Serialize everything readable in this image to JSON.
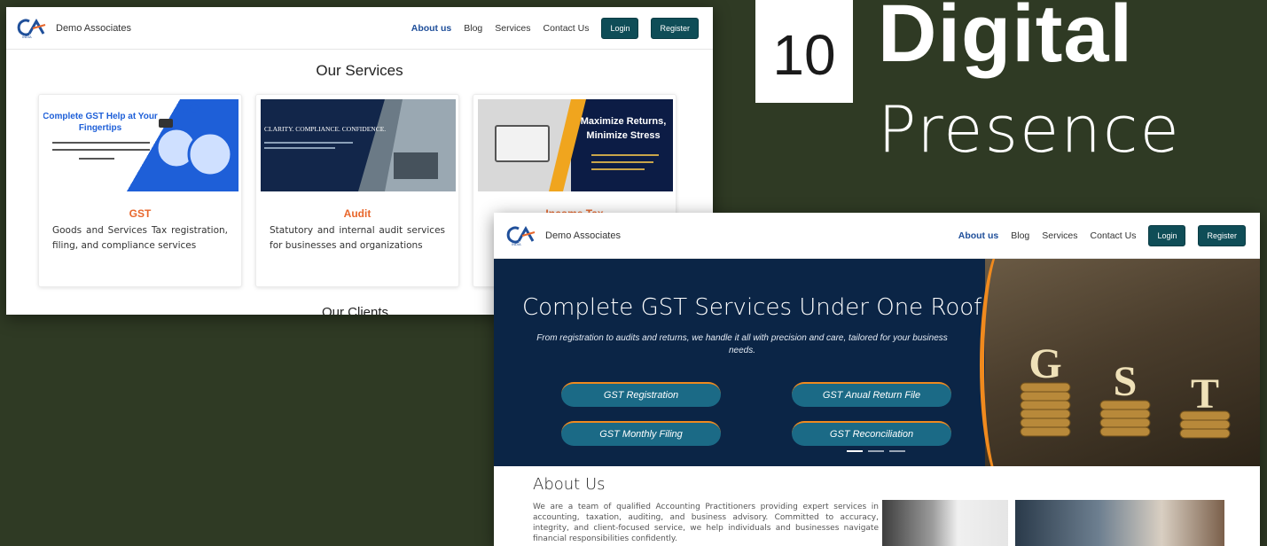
{
  "hero": {
    "number": "10",
    "title_line1": "Digital",
    "title_line2": "Presence"
  },
  "site": {
    "brand": "Demo Associates",
    "logo_text": "INDIA",
    "nav": [
      "About us",
      "Blog",
      "Services",
      "Contact Us"
    ],
    "login_label": "Login",
    "register_label": "Register",
    "accent": "#0f4d57",
    "orange": "#e8672c"
  },
  "services_page": {
    "title": "Our Services",
    "cards": [
      {
        "title": "GST",
        "desc": "Goods and Services Tax registration, filing, and compliance services",
        "img_heading": "Complete GST Help at Your Fingertips"
      },
      {
        "title": "Audit",
        "desc": "Statutory and internal audit services for businesses and organizations",
        "img_heading": "CLARITY. COMPLIANCE. CONFIDENCE."
      },
      {
        "title": "Income Tax",
        "desc": "",
        "img_heading": "Maximize Returns, Minimize Stress"
      }
    ],
    "next_section": "Our Clients"
  },
  "home_page": {
    "hero_title": "Complete GST Services Under One Roof",
    "hero_subtitle": "From registration to audits and returns, we handle it all with precision and care, tailored for your business needs.",
    "buttons": [
      "GST Registration",
      "GST Anual Return File",
      "GST Monthly Filing",
      "GST Reconciliation"
    ],
    "gst_letters": [
      "G",
      "S",
      "T"
    ],
    "about_title": "About Us",
    "about_text": "We are a team of qualified Accounting Practitioners providing expert services in accounting, taxation, auditing, and business advisory. Committed to accuracy, integrity, and client-focused service, we help individuals and businesses navigate financial responsibilities confidently."
  }
}
